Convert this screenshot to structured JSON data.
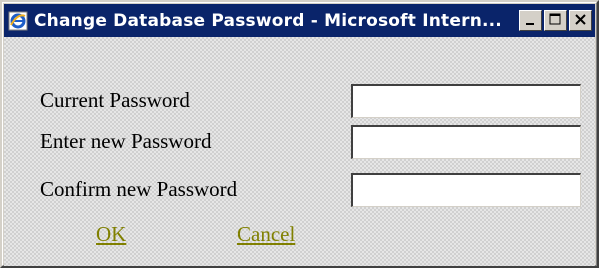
{
  "window": {
    "title": "Change Database Password - Microsoft Intern..."
  },
  "title_bar_controls": {
    "minimize_icon": "minimize-icon",
    "maximize_icon": "maximize-icon",
    "close_icon": "close-icon"
  },
  "form": {
    "fields": [
      {
        "label": "Current Password",
        "value": ""
      },
      {
        "label": "Enter new Password",
        "value": ""
      },
      {
        "label": "Confirm new Password",
        "value": ""
      }
    ],
    "ok_label": "OK",
    "cancel_label": "Cancel"
  },
  "colors": {
    "title_bar": "#0a246a",
    "link": "#808000"
  }
}
